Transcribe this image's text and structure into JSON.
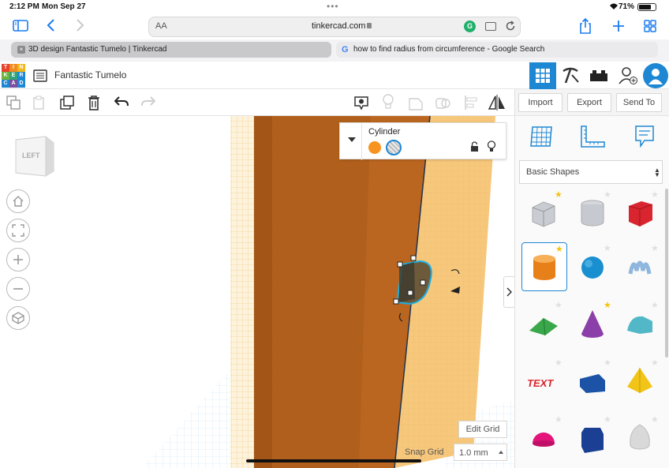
{
  "status": {
    "time": "2:12 PM",
    "date": "Mon Sep 27",
    "battery": "71%"
  },
  "browser": {
    "font_size_label": "AA",
    "url": "tinkercad.com",
    "tabs": [
      {
        "label": "3D design Fantastic Tumelo | Tinkercad"
      },
      {
        "label": "how to find radius from circumference - Google Search"
      }
    ]
  },
  "app": {
    "logo_letters": [
      "T",
      "I",
      "N",
      "K",
      "E",
      "R",
      "C",
      "A",
      "D"
    ],
    "design_name": "Fantastic Tumelo"
  },
  "toolbar": {
    "import_label": "Import",
    "export_label": "Export",
    "send_to_label": "Send To"
  },
  "viewcube": {
    "face_label": "LEFT"
  },
  "inspector": {
    "shape_name": "Cylinder"
  },
  "library": {
    "category": "Basic Shapes",
    "shapes": [
      {
        "name": "Box Grid",
        "starred": true
      },
      {
        "name": "Cylinder Grid",
        "starred": false
      },
      {
        "name": "Box",
        "starred": false
      },
      {
        "name": "Cylinder",
        "starred": true,
        "selected": true
      },
      {
        "name": "Sphere",
        "starred": false
      },
      {
        "name": "Scribble",
        "starred": false
      },
      {
        "name": "Roof",
        "starred": false
      },
      {
        "name": "Cone",
        "starred": true
      },
      {
        "name": "Round Roof",
        "starred": false
      },
      {
        "name": "Text",
        "starred": false
      },
      {
        "name": "Wedge",
        "starred": false
      },
      {
        "name": "Pyramid",
        "starred": false
      },
      {
        "name": "Half Sphere",
        "starred": false
      },
      {
        "name": "Polygon",
        "starred": false
      },
      {
        "name": "Paraboloid",
        "starred": false
      }
    ]
  },
  "grid": {
    "edit_grid_label": "Edit Grid",
    "snap_grid_label": "Snap Grid",
    "snap_value": "1.0 mm"
  },
  "colors": {
    "accent": "#1d87d3",
    "orange": "#f7931e",
    "wood": "#b0601c"
  }
}
